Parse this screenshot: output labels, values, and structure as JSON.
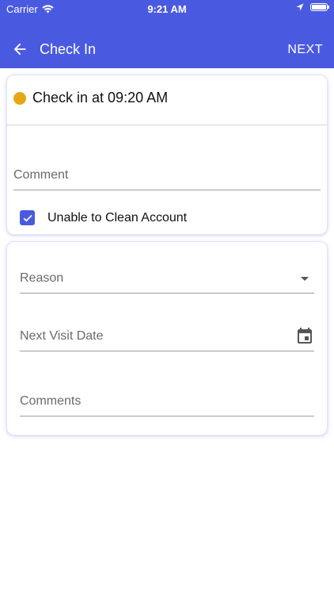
{
  "status_bar": {
    "carrier": "Carrier",
    "time": "9:21 AM"
  },
  "app_bar": {
    "title": "Check In",
    "next_label": "NEXT",
    "color": "#4a5ae0"
  },
  "checkin": {
    "text": "Check in at 09:20 AM",
    "status_color": "#e6a812"
  },
  "comment_field": {
    "placeholder": "Comment"
  },
  "unable_checkbox": {
    "label": "Unable to Clean Account",
    "checked": true
  },
  "reason_field": {
    "placeholder": "Reason",
    "icon": "dropdown-arrow-icon"
  },
  "next_visit_field": {
    "placeholder": "Next Visit Date",
    "icon": "calendar-icon"
  },
  "comments_field": {
    "placeholder": "Comments"
  }
}
